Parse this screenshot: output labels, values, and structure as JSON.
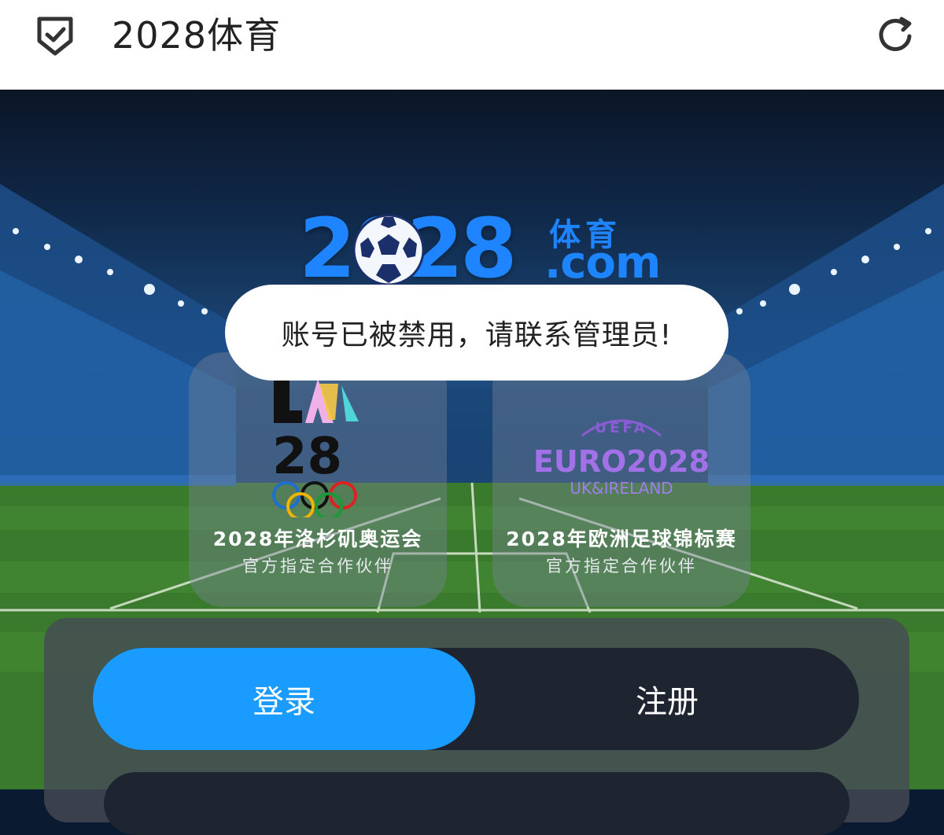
{
  "header": {
    "title": "2028体育",
    "left_icon": "shield-check-icon",
    "right_icon": "refresh-icon"
  },
  "brand": {
    "digits": "2028",
    "cn": "体育",
    "dotcom": ".com",
    "accent": "#1e84ff"
  },
  "toast": {
    "message": "账号已被禁用，请联系管理员!"
  },
  "partners": [
    {
      "emblem_text": "28",
      "title": "2028年洛杉矶奥运会",
      "subtitle": "官方指定合作伙伴"
    },
    {
      "emblem_uefa": "UEFA",
      "emblem_euro": "EURO2028",
      "emblem_region": "UK&IRELAND",
      "title": "2028年欧洲足球锦标赛",
      "subtitle": "官方指定合作伙伴"
    }
  ],
  "auth": {
    "login_label": "登录",
    "register_label": "注册",
    "active_color": "#1a9bff"
  }
}
